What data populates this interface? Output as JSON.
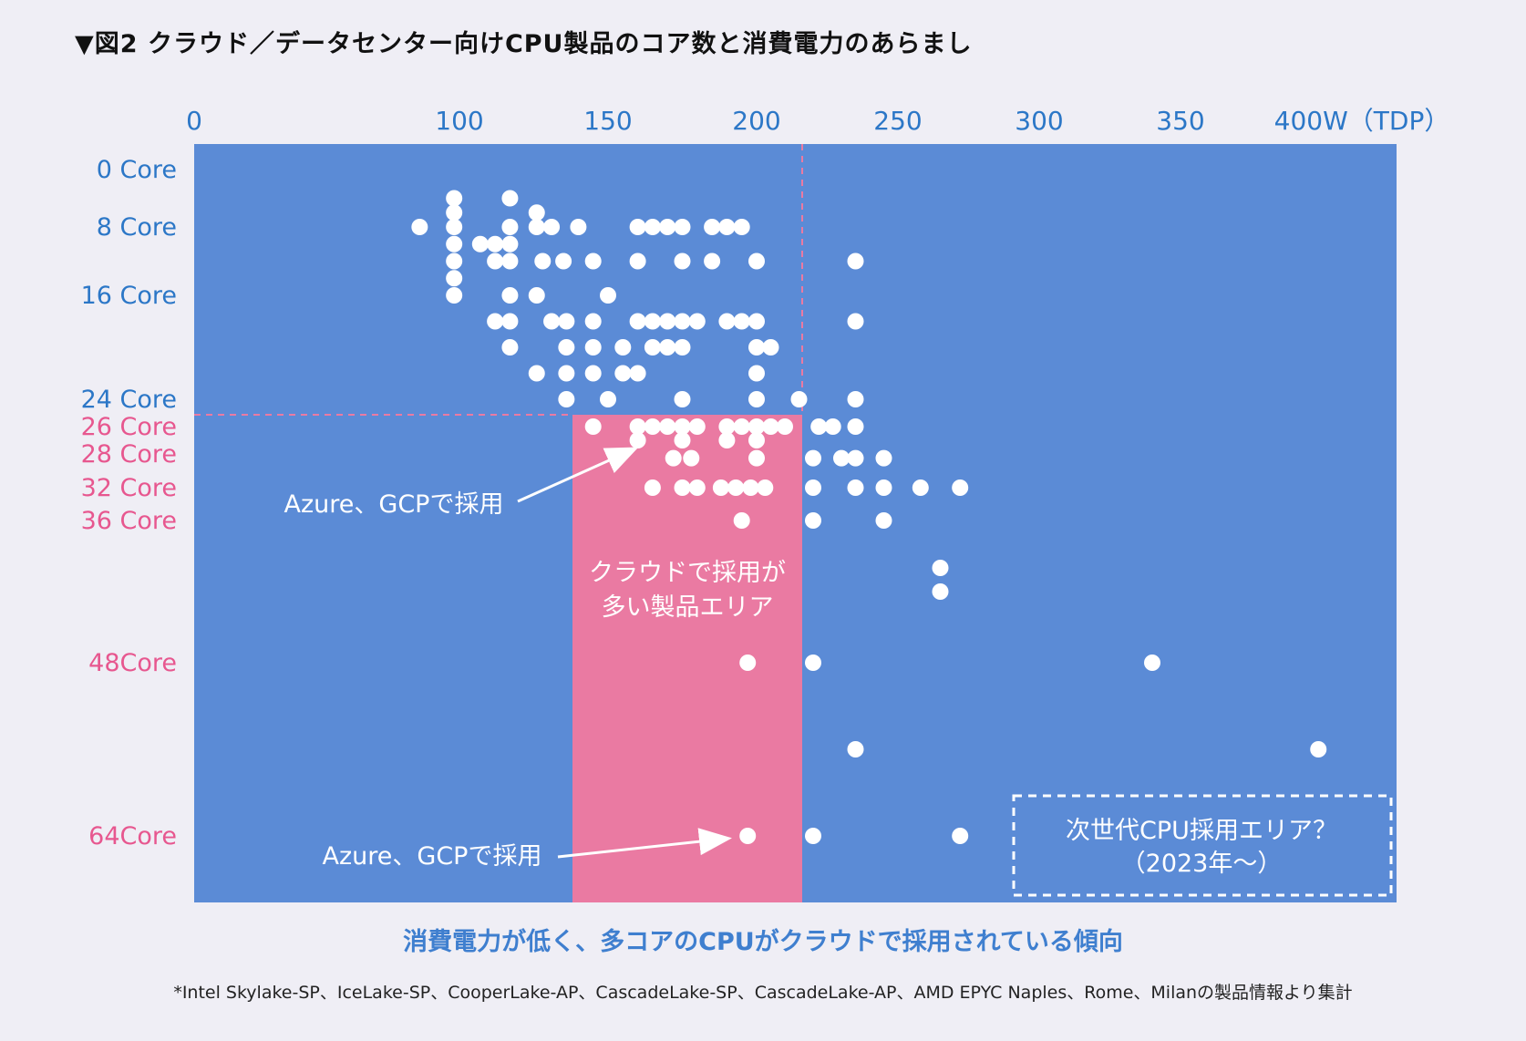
{
  "title": "▼図2 クラウド／データセンター向けCPU製品のコア数と消費電力のあらまし",
  "colors": {
    "plot_bg": "#5b8bd6",
    "cloud_zone": "#ea7aa2",
    "axis_blue": "#2c77c7",
    "axis_pink": "#e7578f",
    "point": "#ffffff"
  },
  "chart_data": {
    "type": "scatter",
    "x_tick_labels": [
      "0",
      "100",
      "150",
      "200",
      "250",
      "300",
      "350",
      "400W（TDP）"
    ],
    "y_tick_labels": [
      "0 Core",
      "8 Core",
      "16 Core",
      "24 Core",
      "26 Core",
      "28 Core",
      "32 Core",
      "36 Core",
      "48Core",
      "64Core"
    ],
    "xlim": [
      0,
      400
    ],
    "cloud_zone_label": "クラウドで採用が\n多い製品エリア",
    "next_gen_label": "次世代CPU採用エリア？\n（2023年～）",
    "annotations": [
      "Azure、GCPで採用",
      "Azure、GCPで採用"
    ],
    "points": [
      {
        "x": 85,
        "y": 8
      },
      {
        "x": 98,
        "y": 4
      },
      {
        "x": 98,
        "y": 6
      },
      {
        "x": 98,
        "y": 8
      },
      {
        "x": 98,
        "y": 10
      },
      {
        "x": 98,
        "y": 12
      },
      {
        "x": 98,
        "y": 14
      },
      {
        "x": 98,
        "y": 16
      },
      {
        "x": 107,
        "y": 10
      },
      {
        "x": 112,
        "y": 10
      },
      {
        "x": 117,
        "y": 4
      },
      {
        "x": 117,
        "y": 8
      },
      {
        "x": 117,
        "y": 10
      },
      {
        "x": 117,
        "y": 12
      },
      {
        "x": 117,
        "y": 16
      },
      {
        "x": 112,
        "y": 12
      },
      {
        "x": 112,
        "y": 18
      },
      {
        "x": 117,
        "y": 18
      },
      {
        "x": 117,
        "y": 20
      },
      {
        "x": 126,
        "y": 6
      },
      {
        "x": 126,
        "y": 8
      },
      {
        "x": 126,
        "y": 16
      },
      {
        "x": 131,
        "y": 8
      },
      {
        "x": 128,
        "y": 12
      },
      {
        "x": 135,
        "y": 12
      },
      {
        "x": 140,
        "y": 8
      },
      {
        "x": 145,
        "y": 12
      },
      {
        "x": 131,
        "y": 18
      },
      {
        "x": 136,
        "y": 18
      },
      {
        "x": 145,
        "y": 18
      },
      {
        "x": 136,
        "y": 20
      },
      {
        "x": 145,
        "y": 20
      },
      {
        "x": 126,
        "y": 22
      },
      {
        "x": 136,
        "y": 22
      },
      {
        "x": 145,
        "y": 22
      },
      {
        "x": 136,
        "y": 24
      },
      {
        "x": 150,
        "y": 16
      },
      {
        "x": 155,
        "y": 20
      },
      {
        "x": 150,
        "y": 24
      },
      {
        "x": 145,
        "y": 26
      },
      {
        "x": 155,
        "y": 22
      },
      {
        "x": 160,
        "y": 22
      },
      {
        "x": 160,
        "y": 8
      },
      {
        "x": 165,
        "y": 8
      },
      {
        "x": 170,
        "y": 8
      },
      {
        "x": 175,
        "y": 8
      },
      {
        "x": 160,
        "y": 12
      },
      {
        "x": 160,
        "y": 18
      },
      {
        "x": 165,
        "y": 18
      },
      {
        "x": 170,
        "y": 18
      },
      {
        "x": 175,
        "y": 18
      },
      {
        "x": 180,
        "y": 18
      },
      {
        "x": 165,
        "y": 20
      },
      {
        "x": 170,
        "y": 20
      },
      {
        "x": 175,
        "y": 20
      },
      {
        "x": 160,
        "y": 26
      },
      {
        "x": 165,
        "y": 26
      },
      {
        "x": 170,
        "y": 26
      },
      {
        "x": 175,
        "y": 26
      },
      {
        "x": 180,
        "y": 26
      },
      {
        "x": 175,
        "y": 12
      },
      {
        "x": 175,
        "y": 24
      },
      {
        "x": 185,
        "y": 12
      },
      {
        "x": 185,
        "y": 8
      },
      {
        "x": 190,
        "y": 8
      },
      {
        "x": 195,
        "y": 8
      },
      {
        "x": 190,
        "y": 18
      },
      {
        "x": 195,
        "y": 18
      },
      {
        "x": 190,
        "y": 26
      },
      {
        "x": 195,
        "y": 26
      },
      {
        "x": 200,
        "y": 12
      },
      {
        "x": 200,
        "y": 18
      },
      {
        "x": 200,
        "y": 20
      },
      {
        "x": 205,
        "y": 20
      },
      {
        "x": 200,
        "y": 22
      },
      {
        "x": 200,
        "y": 24
      },
      {
        "x": 200,
        "y": 26
      },
      {
        "x": 205,
        "y": 26
      },
      {
        "x": 210,
        "y": 26
      },
      {
        "x": 222,
        "y": 26
      },
      {
        "x": 227,
        "y": 26
      },
      {
        "x": 235,
        "y": 12
      },
      {
        "x": 235,
        "y": 18
      },
      {
        "x": 235,
        "y": 24
      },
      {
        "x": 235,
        "y": 26
      },
      {
        "x": 215,
        "y": 24
      },
      {
        "x": 160,
        "y": 27
      },
      {
        "x": 175,
        "y": 27
      },
      {
        "x": 190,
        "y": 27
      },
      {
        "x": 200,
        "y": 27
      },
      {
        "x": 172,
        "y": 28.5
      },
      {
        "x": 178,
        "y": 28.5
      },
      {
        "x": 200,
        "y": 28.5
      },
      {
        "x": 165,
        "y": 32
      },
      {
        "x": 175,
        "y": 32
      },
      {
        "x": 180,
        "y": 32
      },
      {
        "x": 188,
        "y": 32
      },
      {
        "x": 193,
        "y": 32
      },
      {
        "x": 198,
        "y": 32
      },
      {
        "x": 203,
        "y": 32
      },
      {
        "x": 195,
        "y": 36
      },
      {
        "x": 220,
        "y": 28.5
      },
      {
        "x": 230,
        "y": 28.5
      },
      {
        "x": 235,
        "y": 28.5
      },
      {
        "x": 245,
        "y": 28.5
      },
      {
        "x": 220,
        "y": 32
      },
      {
        "x": 235,
        "y": 32
      },
      {
        "x": 245,
        "y": 32
      },
      {
        "x": 258,
        "y": 32
      },
      {
        "x": 272,
        "y": 32
      },
      {
        "x": 220,
        "y": 36
      },
      {
        "x": 245,
        "y": 36
      },
      {
        "x": 265,
        "y": 40
      },
      {
        "x": 265,
        "y": 42
      },
      {
        "x": 197,
        "y": 48
      },
      {
        "x": 220,
        "y": 48
      },
      {
        "x": 340,
        "y": 48
      },
      {
        "x": 235,
        "y": 56
      },
      {
        "x": 388,
        "y": 56
      },
      {
        "x": 197,
        "y": 64
      },
      {
        "x": 220,
        "y": 64
      },
      {
        "x": 272,
        "y": 64
      }
    ]
  },
  "caption": "消費電力が低く、多コアのCPUがクラウドで採用されている傾向",
  "footnote": "*Intel Skylake-SP、IceLake-SP、CooperLake-AP、CascadeLake-SP、CascadeLake-AP、AMD EPYC Naples、Rome、Milanの製品情報より集計"
}
